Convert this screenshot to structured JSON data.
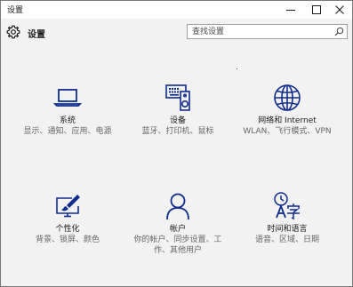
{
  "window": {
    "title": "设置"
  },
  "header": {
    "title": "设置",
    "gear_icon": "gear-icon"
  },
  "search": {
    "placeholder": "查找设置",
    "value": "",
    "icon": "search-icon"
  },
  "tiles": [
    {
      "title": "系统",
      "desc": "显示、通知、应用、电源",
      "icon": "laptop-icon"
    },
    {
      "title": "设备",
      "desc": "蓝牙、打印机、鼠标",
      "icon": "devices-icon"
    },
    {
      "title": "网络和 Internet",
      "desc": "WLAN、飞行模式、VPN",
      "icon": "globe-icon"
    },
    {
      "title": "个性化",
      "desc": "背景、锁屏、颜色",
      "icon": "personalization-icon"
    },
    {
      "title": "帐户",
      "desc": "你的帐户、同步设置、工作、其他用户",
      "icon": "person-icon"
    },
    {
      "title": "时间和语言",
      "desc": "语音、区域、日期",
      "icon": "time-language-icon"
    }
  ],
  "colors": {
    "accent": "#0f2d8c",
    "background": "#f2f2f2",
    "titlebar": "#ffffff"
  }
}
